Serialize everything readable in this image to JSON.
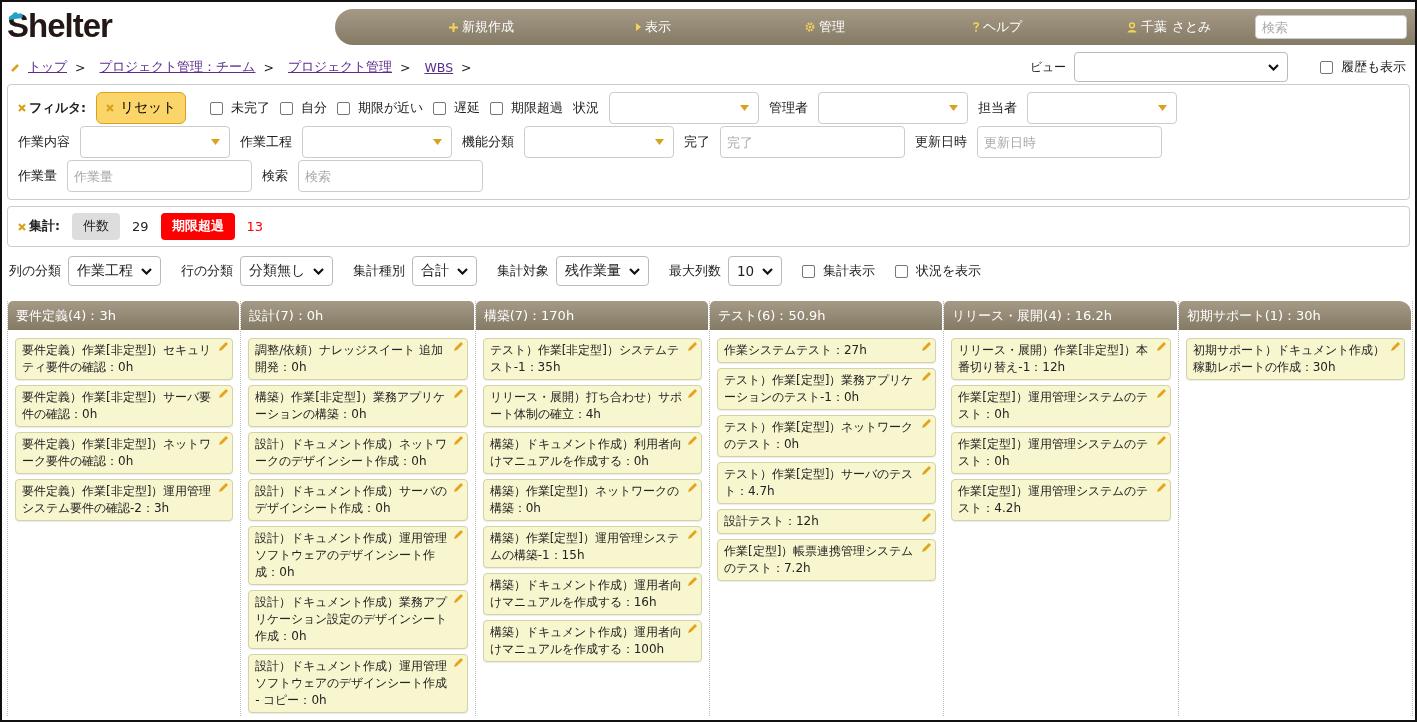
{
  "logo": {
    "text": "Shelter"
  },
  "nav": {
    "items": [
      {
        "label": "新規作成",
        "kind": "create"
      },
      {
        "label": "表示",
        "kind": "view"
      },
      {
        "label": "管理",
        "kind": "admin"
      },
      {
        "label": "ヘルプ",
        "kind": "help"
      },
      {
        "label": "千葉 さとみ",
        "kind": "user"
      }
    ],
    "search": {
      "placeholder": "検索"
    }
  },
  "breadcrumb": [
    {
      "label": "トップ",
      "separator": ">"
    },
    {
      "label": "プロジェクト管理：チーム",
      "separator": ">"
    },
    {
      "label": "プロジェクト管理",
      "separator": ">"
    },
    {
      "label": "WBS",
      "separator": ">"
    }
  ],
  "view": {
    "label": "ビュー",
    "history": {
      "label": "履歴も表示",
      "checked": false
    }
  },
  "filter": {
    "title": "フィルタ:",
    "reset": "リセット",
    "checkboxes": [
      {
        "label": "未完了",
        "checked": false
      },
      {
        "label": "自分",
        "checked": false
      },
      {
        "label": "期限が近い",
        "checked": false
      },
      {
        "label": "遅延",
        "checked": false
      },
      {
        "label": "期限超過",
        "checked": false
      }
    ],
    "lines": [
      {
        "fields": [
          {
            "label": "状況",
            "kind": "dropdown"
          },
          {
            "label": "管理者",
            "kind": "dropdown"
          },
          {
            "label": "担当者",
            "kind": "dropdown"
          }
        ]
      },
      {
        "fields": [
          {
            "label": "作業内容",
            "kind": "dropdown"
          },
          {
            "label": "作業工程",
            "kind": "dropdown"
          },
          {
            "label": "機能分類",
            "kind": "dropdown"
          },
          {
            "label": "完了",
            "kind": "text",
            "placeholder": "完了"
          },
          {
            "label": "更新日時",
            "kind": "text",
            "placeholder": "更新日時"
          }
        ]
      },
      {
        "fields": [
          {
            "label": "作業量",
            "kind": "text",
            "placeholder": "作業量"
          },
          {
            "label": "検索",
            "kind": "text",
            "placeholder": "検索"
          }
        ]
      }
    ]
  },
  "summary": {
    "title": "集計:",
    "count_label": "件数",
    "count": "29",
    "overdue_label": "期限超過",
    "overdue": "13"
  },
  "options": {
    "selects": [
      {
        "label": "列の分類",
        "value": "作業工程"
      },
      {
        "label": "行の分類",
        "value": "分類無し"
      },
      {
        "label": "集計種別",
        "value": "合計"
      },
      {
        "label": "集計対象",
        "value": "残作業量"
      },
      {
        "label": "最大列数",
        "value": "10"
      }
    ],
    "checkboxes": [
      {
        "label": "集計表示",
        "checked": false
      },
      {
        "label": "状況を表示",
        "checked": false
      }
    ]
  },
  "board": [
    {
      "title": "要件定義(4)：3h",
      "cards": [
        "要件定義）作業[非定型]）セキュリティ要件の確認：0h",
        "要件定義）作業[非定型]）サーバ要件の確認：0h",
        "要件定義）作業[非定型]）ネットワーク要件の確認：0h",
        "要件定義）作業[非定型]）運用管理システム要件の確認-2：3h"
      ]
    },
    {
      "title": "設計(7)：0h",
      "cards": [
        "調整/依頼）ナレッジスイート 追加開発：0h",
        "構築）作業[非定型]）業務アプリケーションの構築：0h",
        "設計）ドキュメント作成）ネットワークのデザインシート作成：0h",
        "設計）ドキュメント作成）サーバのデザインシート作成：0h",
        "設計）ドキュメント作成）運用管理ソフトウェアのデザインシート作成：0h",
        "設計）ドキュメント作成）業務アプリケーション設定のデザインシート作成：0h",
        "設計）ドキュメント作成）運用管理ソフトウェアのデザインシート作成 - コピー：0h"
      ]
    },
    {
      "title": "構築(7)：170h",
      "cards": [
        "テスト）作業[非定型]）システムテスト-1：35h",
        "リリース・展開）打ち合わせ）サポート体制の確立：4h",
        "構築）ドキュメント作成）利用者向けマニュアルを作成する：0h",
        "構築）作業[定型]）ネットワークの構築：0h",
        "構築）作業[定型]）運用管理システムの構築-1：15h",
        "構築）ドキュメント作成）運用者向けマニュアルを作成する：16h",
        "構築）ドキュメント作成）運用者向けマニュアルを作成する：100h"
      ]
    },
    {
      "title": "テスト(6)：50.9h",
      "cards": [
        "作業システムテスト：27h",
        "テスト）作業[定型]）業務アプリケーションのテスト-1：0h",
        "テスト）作業[定型]）ネットワークのテスト：0h",
        "テスト）作業[定型]）サーバのテスト：4.7h",
        "設計テスト：12h",
        "作業[定型]）帳票連携管理システムのテスト：7.2h"
      ]
    },
    {
      "title": "リリース・展開(4)：16.2h",
      "cards": [
        "リリース・展開）作業[非定型]）本番切り替え-1：12h",
        "作業[定型]）運用管理システムのテスト：0h",
        "作業[定型]）運用管理システムのテスト：0h",
        "作業[定型]）運用管理システムのテスト：4.2h"
      ]
    },
    {
      "title": "初期サポート(1)：30h",
      "cards": [
        "初期サポート）ドキュメント作成）稼動レポートの作成：30h"
      ]
    }
  ]
}
